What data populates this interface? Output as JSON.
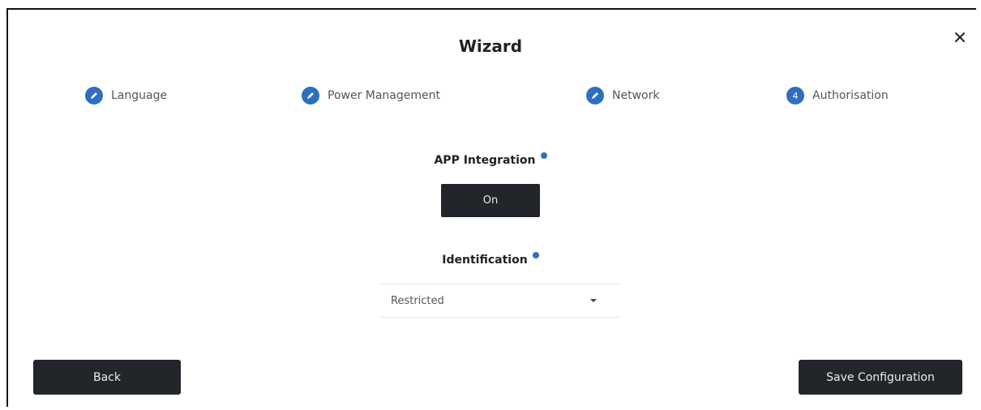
{
  "wizard": {
    "title": "Wizard",
    "close_icon": "close-icon"
  },
  "steps": [
    {
      "label": "Language",
      "state": "completed",
      "icon": "pencil-icon"
    },
    {
      "label": "Power Management",
      "state": "completed",
      "icon": "pencil-icon"
    },
    {
      "label": "Network",
      "state": "completed",
      "icon": "pencil-icon"
    },
    {
      "label": "Authorisation",
      "state": "current",
      "number": "4"
    }
  ],
  "app_integration": {
    "label": "APP Integration",
    "toggle_value": "On"
  },
  "identification": {
    "label": "Identification",
    "selected": "Restricted"
  },
  "footer": {
    "back_label": "Back",
    "save_label": "Save Configuration"
  },
  "colors": {
    "accent": "#2f6fbf",
    "button_dark": "#22262b"
  }
}
